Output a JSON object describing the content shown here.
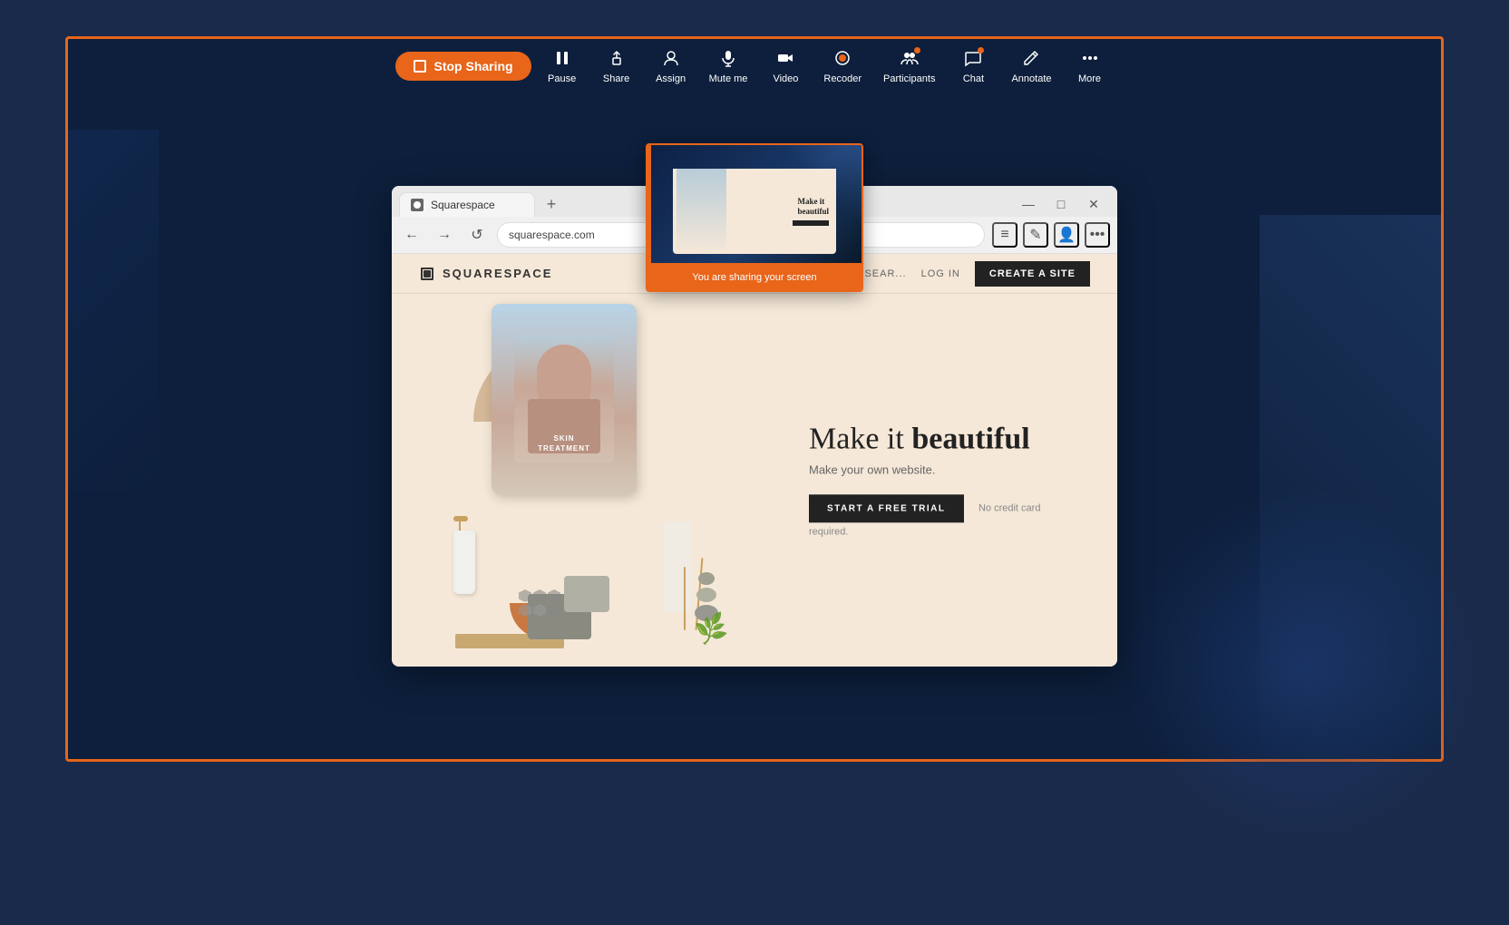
{
  "outer": {
    "border_color": "#e8651a"
  },
  "toolbar": {
    "stop_sharing_label": "Stop Sharing",
    "items": [
      {
        "id": "pause",
        "label": "Pause",
        "icon": "⏸",
        "badge": false
      },
      {
        "id": "share",
        "label": "Share",
        "icon": "⬆",
        "badge": false
      },
      {
        "id": "assign",
        "label": "Assign",
        "icon": "👤",
        "badge": false
      },
      {
        "id": "mute_me",
        "label": "Mute me",
        "icon": "🎤",
        "badge": false
      },
      {
        "id": "video",
        "label": "Video",
        "icon": "📷",
        "badge": false
      },
      {
        "id": "recoder",
        "label": "Recoder",
        "icon": "⏺",
        "badge": false
      },
      {
        "id": "participants",
        "label": "Participants",
        "icon": "👥",
        "badge": true
      },
      {
        "id": "chat",
        "label": "Chat",
        "icon": "💬",
        "badge": true
      },
      {
        "id": "annotate",
        "label": "Annotate",
        "icon": "✏",
        "badge": false
      },
      {
        "id": "more",
        "label": "More",
        "icon": "•••",
        "badge": false
      }
    ]
  },
  "browser": {
    "tab_label": "Squarespace",
    "new_tab_label": "+",
    "nav": {
      "back": "←",
      "forward": "→",
      "refresh": "↺",
      "address": "squarespace.com"
    },
    "window_controls": {
      "minimize": "—",
      "maximize": "□",
      "close": "✕"
    },
    "action_icons": [
      "≡",
      "✎",
      "👤",
      "•••"
    ]
  },
  "squarespace": {
    "logo_text": "SQUARESPACE",
    "nav_search": "SEAR...",
    "login": "LOG IN",
    "create_btn": "CREATE A SITE",
    "hero": {
      "headline_regular": "Make it ",
      "headline_bold": "beautiful",
      "subheadline": "Make your own website.",
      "trial_btn": "START A FREE TRIAL",
      "no_card": "No credit card required."
    }
  },
  "screen_sharing": {
    "preview_label": "You are sharing your screen"
  }
}
